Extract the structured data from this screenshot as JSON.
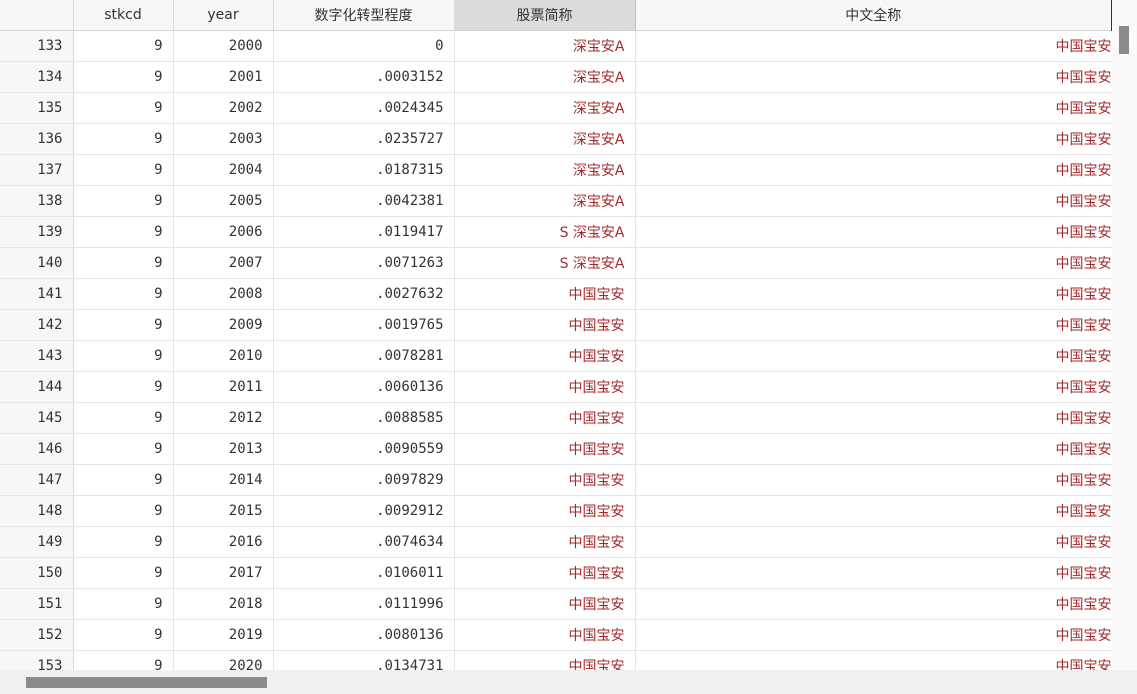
{
  "columns": [
    "stkcd",
    "year",
    "数字化转型程度",
    "股票简称",
    "中文全称"
  ],
  "rows": [
    {
      "n": "133",
      "stkcd": "9",
      "year": "2000",
      "dig": "0",
      "abbr": "深宝安A",
      "full": "中国宝安"
    },
    {
      "n": "134",
      "stkcd": "9",
      "year": "2001",
      "dig": ".0003152",
      "abbr": "深宝安A",
      "full": "中国宝安"
    },
    {
      "n": "135",
      "stkcd": "9",
      "year": "2002",
      "dig": ".0024345",
      "abbr": "深宝安A",
      "full": "中国宝安"
    },
    {
      "n": "136",
      "stkcd": "9",
      "year": "2003",
      "dig": ".0235727",
      "abbr": "深宝安A",
      "full": "中国宝安"
    },
    {
      "n": "137",
      "stkcd": "9",
      "year": "2004",
      "dig": ".0187315",
      "abbr": "深宝安A",
      "full": "中国宝安"
    },
    {
      "n": "138",
      "stkcd": "9",
      "year": "2005",
      "dig": ".0042381",
      "abbr": "深宝安A",
      "full": "中国宝安"
    },
    {
      "n": "139",
      "stkcd": "9",
      "year": "2006",
      "dig": ".0119417",
      "abbr": "S 深宝安A",
      "full": "中国宝安"
    },
    {
      "n": "140",
      "stkcd": "9",
      "year": "2007",
      "dig": ".0071263",
      "abbr": "S 深宝安A",
      "full": "中国宝安"
    },
    {
      "n": "141",
      "stkcd": "9",
      "year": "2008",
      "dig": ".0027632",
      "abbr": "中国宝安",
      "full": "中国宝安"
    },
    {
      "n": "142",
      "stkcd": "9",
      "year": "2009",
      "dig": ".0019765",
      "abbr": "中国宝安",
      "full": "中国宝安"
    },
    {
      "n": "143",
      "stkcd": "9",
      "year": "2010",
      "dig": ".0078281",
      "abbr": "中国宝安",
      "full": "中国宝安"
    },
    {
      "n": "144",
      "stkcd": "9",
      "year": "2011",
      "dig": ".0060136",
      "abbr": "中国宝安",
      "full": "中国宝安"
    },
    {
      "n": "145",
      "stkcd": "9",
      "year": "2012",
      "dig": ".0088585",
      "abbr": "中国宝安",
      "full": "中国宝安"
    },
    {
      "n": "146",
      "stkcd": "9",
      "year": "2013",
      "dig": ".0090559",
      "abbr": "中国宝安",
      "full": "中国宝安"
    },
    {
      "n": "147",
      "stkcd": "9",
      "year": "2014",
      "dig": ".0097829",
      "abbr": "中国宝安",
      "full": "中国宝安"
    },
    {
      "n": "148",
      "stkcd": "9",
      "year": "2015",
      "dig": ".0092912",
      "abbr": "中国宝安",
      "full": "中国宝安"
    },
    {
      "n": "149",
      "stkcd": "9",
      "year": "2016",
      "dig": ".0074634",
      "abbr": "中国宝安",
      "full": "中国宝安"
    },
    {
      "n": "150",
      "stkcd": "9",
      "year": "2017",
      "dig": ".0106011",
      "abbr": "中国宝安",
      "full": "中国宝安"
    },
    {
      "n": "151",
      "stkcd": "9",
      "year": "2018",
      "dig": ".0111996",
      "abbr": "中国宝安",
      "full": "中国宝安"
    },
    {
      "n": "152",
      "stkcd": "9",
      "year": "2019",
      "dig": ".0080136",
      "abbr": "中国宝安",
      "full": "中国宝安"
    },
    {
      "n": "153",
      "stkcd": "9",
      "year": "2020",
      "dig": ".0134731",
      "abbr": "中国宝安",
      "full": "中国宝安"
    }
  ],
  "colors": {
    "string_text": "#a52a2a",
    "header_bg": "#f7f7f7",
    "selected_header_bg": "#dcdcdc"
  }
}
